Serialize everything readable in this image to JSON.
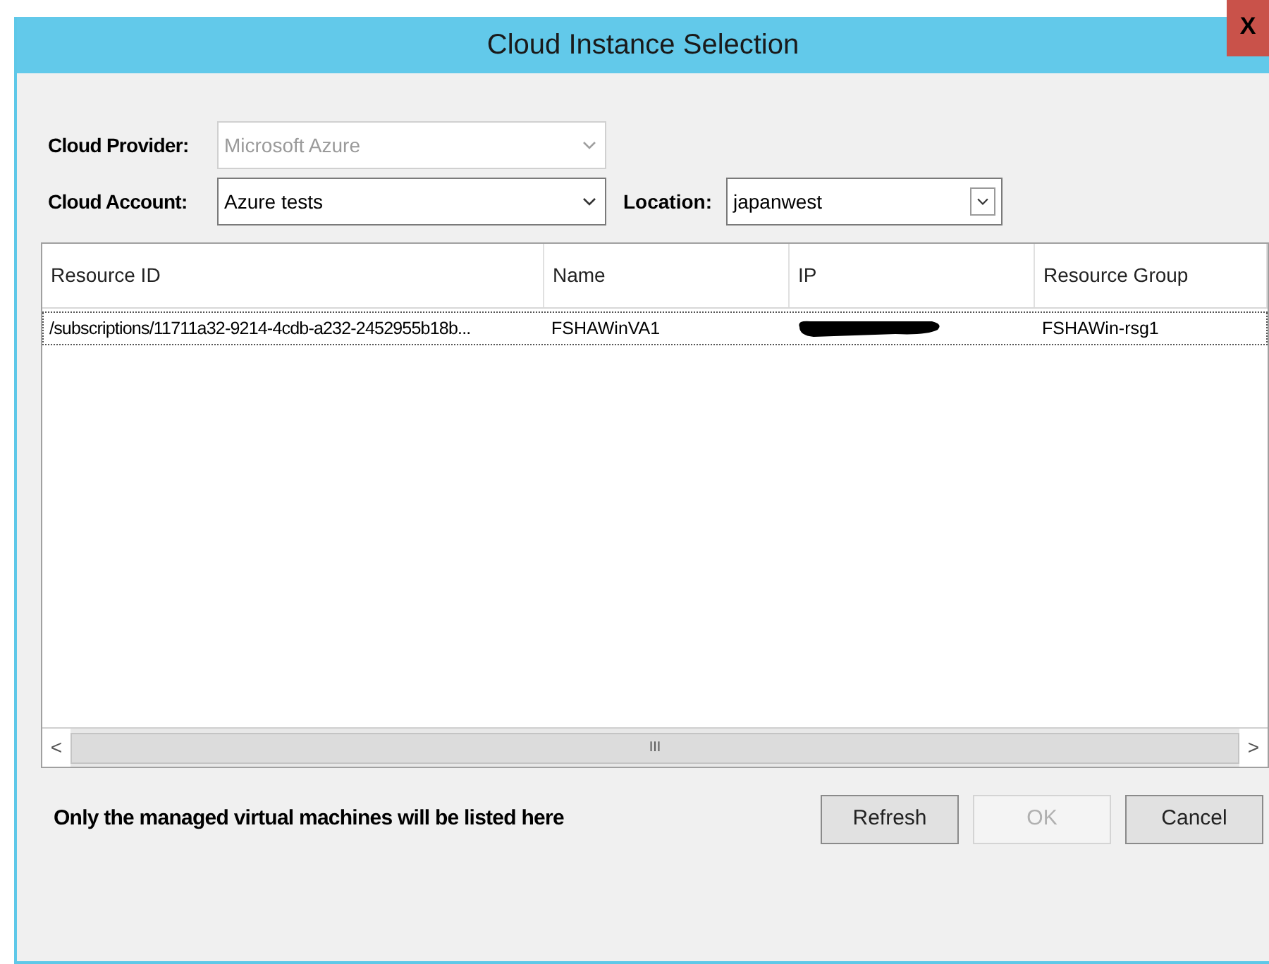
{
  "window": {
    "title": "Cloud Instance Selection",
    "close": "X"
  },
  "fields": [
    {
      "label": "Cloud Provider:",
      "value": "Microsoft Azure",
      "disabled": true
    },
    {
      "label": "Cloud Account:",
      "value": "Azure tests",
      "disabled": false
    },
    {
      "label": "Location:",
      "value": "japanwest",
      "disabled": false
    }
  ],
  "table": {
    "columns": [
      "Resource ID",
      "Name",
      "IP",
      "Resource Group"
    ],
    "rows": [
      {
        "cells": [
          {
            "kind": "text",
            "text": "/subscriptions/11711a32-9214-4cdb-a232-2452955b18b..."
          },
          {
            "kind": "text",
            "text": "FSHAWinVA1"
          },
          {
            "kind": "redacted"
          },
          {
            "kind": "text",
            "text": "FSHAWin-rsg1"
          }
        ]
      }
    ]
  },
  "scrollbar": {
    "left": "<",
    "grip": "III",
    "right": ">"
  },
  "note": "Only the managed virtual machines will be listed here",
  "buttons": [
    {
      "label": "Refresh",
      "disabled": false
    },
    {
      "label": "OK",
      "disabled": true
    },
    {
      "label": "Cancel",
      "disabled": false
    }
  ]
}
